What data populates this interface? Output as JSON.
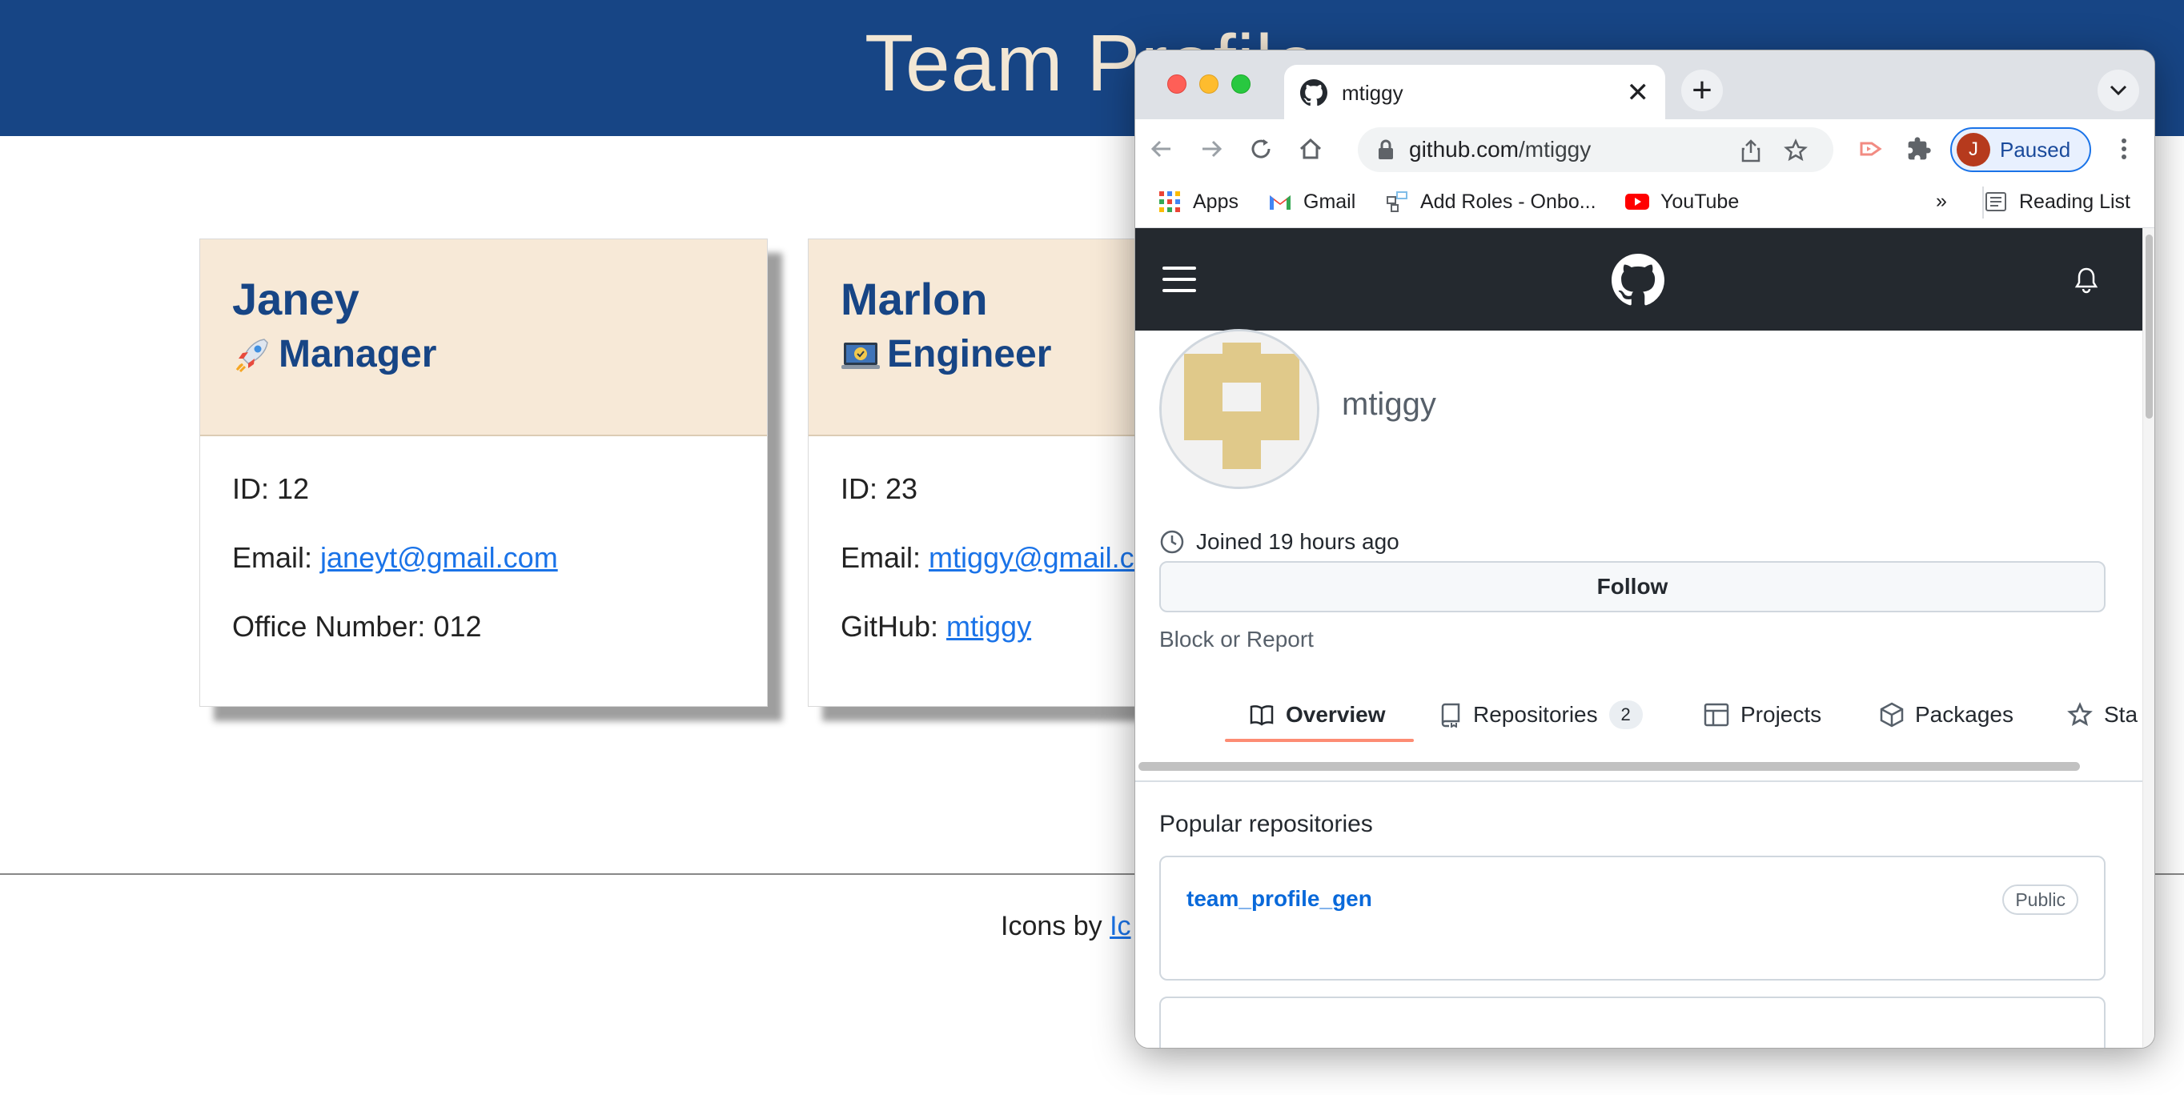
{
  "page": {
    "title": "Team Profile"
  },
  "cards": [
    {
      "name": "Janey",
      "role": "Manager",
      "role_icon": "rocket-icon",
      "id_line": "ID: 12",
      "email_label": "Email: ",
      "email": "janeyt@gmail.com",
      "extra_label": "Office Number: 012",
      "extra_link": ""
    },
    {
      "name": "Marlon",
      "role": "Engineer",
      "role_icon": "laptop-icon",
      "id_line": "ID: 23",
      "email_label": "Email: ",
      "email": "mtiggy@gmail.co",
      "extra_label": "GitHub: ",
      "extra_link": "mtiggy"
    }
  ],
  "footer": {
    "prefix": "Icons by ",
    "link": "Ic"
  },
  "browser": {
    "tab_title": "mtiggy",
    "url_host": "github.com",
    "url_path": "/mtiggy",
    "profile_initial": "J",
    "profile_status": "Paused",
    "bookmarks": [
      {
        "label": "Apps",
        "icon": "apps-grid-icon"
      },
      {
        "label": "Gmail",
        "icon": "gmail-icon"
      },
      {
        "label": "Add Roles - Onbo...",
        "icon": "onboarding-icon"
      },
      {
        "label": "YouTube",
        "icon": "youtube-icon"
      }
    ],
    "bookmarks_overflow": "»",
    "reading_list": "Reading List"
  },
  "github": {
    "username": "mtiggy",
    "joined": "Joined 19 hours ago",
    "follow_label": "Follow",
    "block_label": "Block or Report",
    "tabs": [
      {
        "label": "Overview",
        "icon": "book-icon",
        "active": true
      },
      {
        "label": "Repositories",
        "icon": "repo-icon",
        "count": "2"
      },
      {
        "label": "Projects",
        "icon": "table-icon"
      },
      {
        "label": "Packages",
        "icon": "package-icon"
      },
      {
        "label": "Sta",
        "icon": "star-icon"
      }
    ],
    "popular_heading": "Popular repositories",
    "repos": [
      {
        "name": "team_profile_gen",
        "visibility": "Public"
      }
    ]
  },
  "colors": {
    "header_bg": "#174585",
    "title_text": "#f3e7d4",
    "card_head_bg": "#f7e9d7",
    "link": "#1a73e8",
    "github_header": "#24292f",
    "github_link": "#0969da"
  }
}
